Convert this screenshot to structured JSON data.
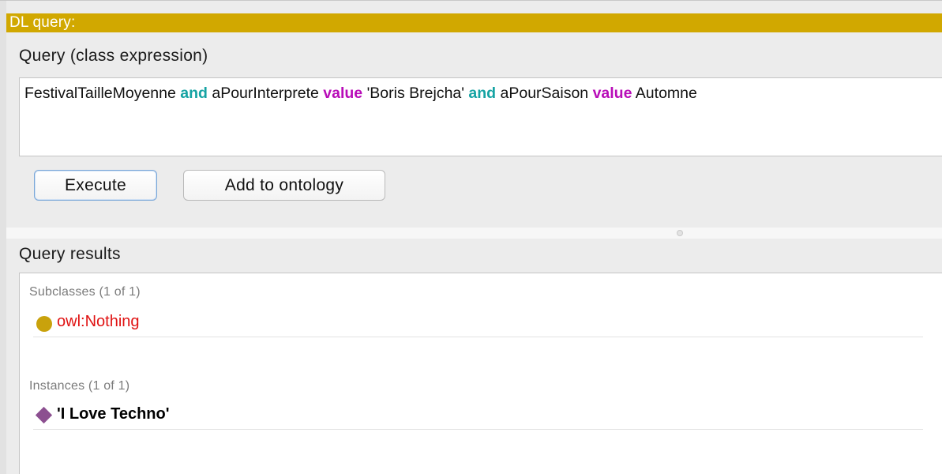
{
  "panel": {
    "title": "DL query:"
  },
  "query": {
    "section_label": "Query (class expression)",
    "tokens": [
      {
        "text": "FestivalTailleMoyenne ",
        "kind": "plain"
      },
      {
        "text": "and",
        "kind": "and"
      },
      {
        "text": " aPourInterprete ",
        "kind": "plain"
      },
      {
        "text": "value",
        "kind": "value"
      },
      {
        "text": " 'Boris Brejcha' ",
        "kind": "plain"
      },
      {
        "text": "and",
        "kind": "and"
      },
      {
        "text": " aPourSaison ",
        "kind": "plain"
      },
      {
        "text": "value",
        "kind": "value"
      },
      {
        "text": " Automne",
        "kind": "plain"
      }
    ]
  },
  "buttons": {
    "execute": "Execute",
    "add_to_ontology": "Add to ontology"
  },
  "results": {
    "section_label": "Query results",
    "subclasses": {
      "header": "Subclasses (1 of 1)",
      "items": [
        {
          "label": "owl:Nothing",
          "icon": "class-circle-icon"
        }
      ]
    },
    "instances": {
      "header": "Instances (1 of 1)",
      "items": [
        {
          "label": "'I Love Techno'",
          "icon": "individual-diamond-icon"
        }
      ]
    }
  },
  "colors": {
    "title_bar": "#d1a800",
    "keyword_and": "#15a3a3",
    "keyword_value": "#b80db8",
    "nothing_text": "#e01313",
    "class_icon": "#c9a20c",
    "individual_icon": "#8c4f90"
  }
}
